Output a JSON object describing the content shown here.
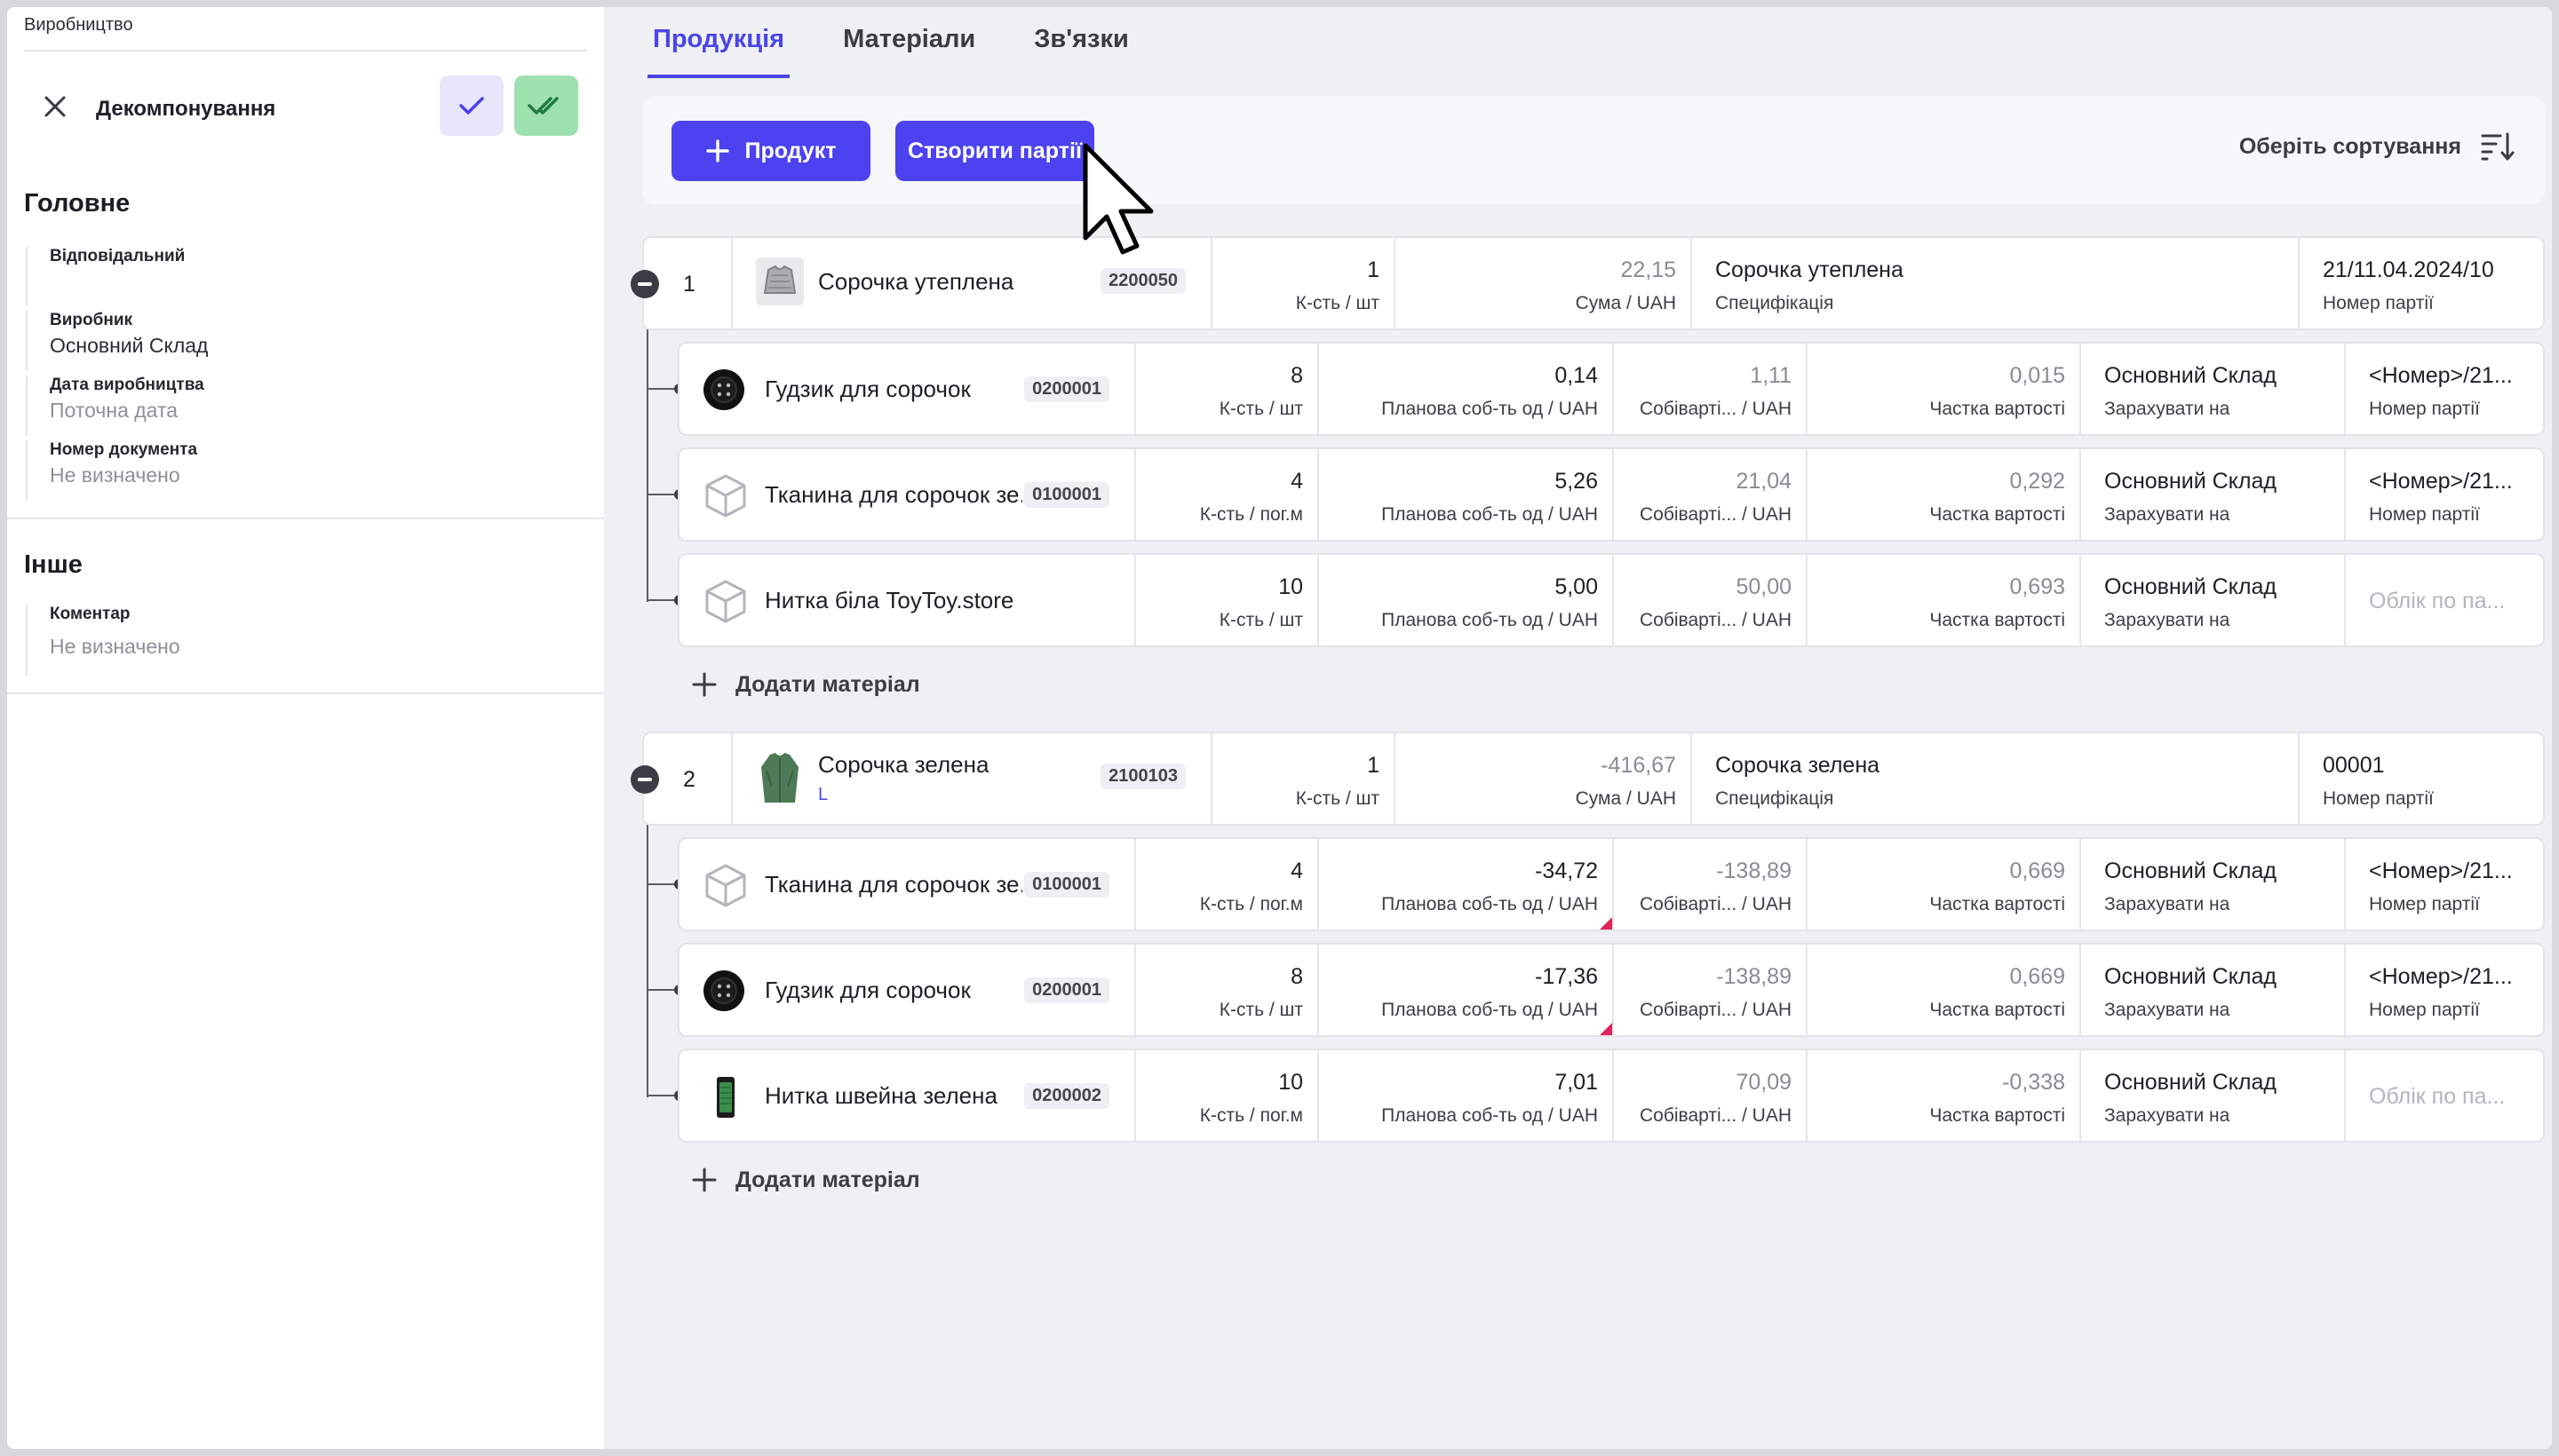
{
  "sidebar": {
    "header": "Виробництво",
    "title": "Декомпонування",
    "sections": {
      "main_title": "Головне",
      "other_title": "Інше"
    },
    "fields": [
      {
        "label": "Відповідальний",
        "value": ""
      },
      {
        "label": "Виробник",
        "value": "Основний Склад"
      },
      {
        "label": "Дата виробництва",
        "value": "Поточна дата"
      },
      {
        "label": "Номер документа",
        "value": "Не визначено"
      }
    ],
    "comment": {
      "label": "Коментар",
      "value": "Не визначено"
    }
  },
  "tabs": [
    {
      "label": "Продукція",
      "active": true
    },
    {
      "label": "Матеріали",
      "active": false
    },
    {
      "label": "Зв'язки",
      "active": false
    }
  ],
  "toolbar": {
    "add_product": "Продукт",
    "create_batches": "Створити партії",
    "sort": "Оберіть сортування"
  },
  "labels": {
    "qty_unit_sep": "/",
    "add_material": "Додати матеріал"
  },
  "groups": [
    {
      "index": "1",
      "product": {
        "name": "Сорочка утеплена",
        "size": "",
        "code": "2200050",
        "qty": "1",
        "qty_label": "К-сть / шт",
        "sum": "22,15",
        "sum_label": "Сума / UAH",
        "spec": "Сорочка утеплена",
        "spec_label": "Специфікація",
        "batch": "21/11.04.2024/10",
        "batch_label": "Номер партії",
        "icon": "jacket-icon"
      },
      "materials": [
        {
          "name": "Гудзик для сорочок",
          "code": "0200001",
          "icon": "button-icon",
          "qty": "8",
          "qty_label": "К-сть / шт",
          "plan": "0,14",
          "plan_label": "Планова соб-ть од / UAH",
          "cost": "1,11",
          "cost_label": "Собіварті... / UAH",
          "share": "0,015",
          "share_label": "Частка вартості",
          "warehouse": "Основний Склад",
          "warehouse_label": "Зарахувати на",
          "batch": "<Номер>/21...",
          "batch_label": "Номер партії",
          "batch_muted": false,
          "flag": false
        },
        {
          "name": "Тканина для сорочок зе...",
          "code": "0100001",
          "icon": "box-icon",
          "qty": "4",
          "qty_label": "К-сть / пог.м",
          "plan": "5,26",
          "plan_label": "Планова соб-ть од / UAH",
          "cost": "21,04",
          "cost_label": "Собіварті... / UAH",
          "share": "0,292",
          "share_label": "Частка вартості",
          "warehouse": "Основний Склад",
          "warehouse_label": "Зарахувати на",
          "batch": "<Номер>/21...",
          "batch_label": "Номер партії",
          "batch_muted": false,
          "flag": false
        },
        {
          "name": "Нитка біла ToyToy.store",
          "code": "",
          "icon": "box-icon",
          "qty": "10",
          "qty_label": "К-сть / шт",
          "plan": "5,00",
          "plan_label": "Планова соб-ть од / UAH",
          "cost": "50,00",
          "cost_label": "Собіварті... / UAH",
          "share": "0,693",
          "share_label": "Частка вартості",
          "warehouse": "Основний Склад",
          "warehouse_label": "Зарахувати на",
          "batch": "Облік по па...",
          "batch_label": "",
          "batch_muted": true,
          "flag": false
        }
      ]
    },
    {
      "index": "2",
      "product": {
        "name": "Сорочка зелена",
        "size": "L",
        "code": "2100103",
        "qty": "1",
        "qty_label": "К-сть / шт",
        "sum": "-416,67",
        "sum_label": "Сума / UAH",
        "spec": "Сорочка зелена",
        "spec_label": "Специфікація",
        "batch": "00001",
        "batch_label": "Номер партії",
        "icon": "shirt-icon"
      },
      "materials": [
        {
          "name": "Тканина для сорочок зе...",
          "code": "0100001",
          "icon": "box-icon",
          "qty": "4",
          "qty_label": "К-сть / пог.м",
          "plan": "-34,72",
          "plan_label": "Планова соб-ть од / UAH",
          "cost": "-138,89",
          "cost_label": "Собіварті... / UAH",
          "share": "0,669",
          "share_label": "Частка вартості",
          "warehouse": "Основний Склад",
          "warehouse_label": "Зарахувати на",
          "batch": "<Номер>/21...",
          "batch_label": "Номер партії",
          "batch_muted": false,
          "flag": true
        },
        {
          "name": "Гудзик для сорочок",
          "code": "0200001",
          "icon": "button-icon",
          "qty": "8",
          "qty_label": "К-сть / шт",
          "plan": "-17,36",
          "plan_label": "Планова соб-ть од / UAH",
          "cost": "-138,89",
          "cost_label": "Собіварті... / UAH",
          "share": "0,669",
          "share_label": "Частка вартості",
          "warehouse": "Основний Склад",
          "warehouse_label": "Зарахувати на",
          "batch": "<Номер>/21...",
          "batch_label": "Номер партії",
          "batch_muted": false,
          "flag": true
        },
        {
          "name": "Нитка швейна зелена",
          "code": "0200002",
          "icon": "thread-icon",
          "qty": "10",
          "qty_label": "К-сть / пог.м",
          "plan": "7,01",
          "plan_label": "Планова соб-ть од / UAH",
          "cost": "70,09",
          "cost_label": "Собіварті... / UAH",
          "share": "-0,338",
          "share_label": "Частка вартості",
          "warehouse": "Основний Склад",
          "warehouse_label": "Зарахувати на",
          "batch": "Облік по па...",
          "batch_label": "",
          "batch_muted": true,
          "flag": false
        }
      ]
    }
  ],
  "colors": {
    "accent": "#4c42f0",
    "confirm_bg": "#e7e6fb",
    "confirm_all_bg": "#9fe0b0",
    "warning_flag": "#e0245e"
  }
}
